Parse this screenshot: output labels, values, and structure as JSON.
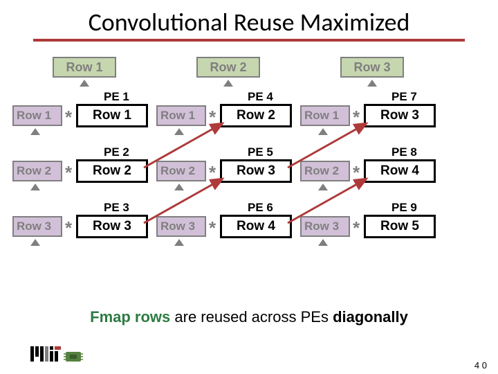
{
  "title": "Convolutional Reuse Maximized",
  "fmap_top": [
    "Row 1",
    "Row 2",
    "Row 3"
  ],
  "filter_labels": [
    "Row 1",
    "Row 2",
    "Row 3"
  ],
  "asterisk": "*",
  "grid": {
    "col1": {
      "pe": [
        "PE 1",
        "PE 2",
        "PE 3"
      ],
      "data": [
        "Row 1",
        "Row 2",
        "Row 3"
      ]
    },
    "col2": {
      "pe": [
        "PE 4",
        "PE 5",
        "PE 6"
      ],
      "data": [
        "Row 2",
        "Row 3",
        "Row 4"
      ]
    },
    "col3": {
      "pe": [
        "PE 7",
        "PE 8",
        "PE 9"
      ],
      "data": [
        "Row 3",
        "Row 4",
        "Row 5"
      ]
    }
  },
  "footer": {
    "fmap_word": "Fmap rows",
    "mid": " are reused across PEs ",
    "bold": "diagonally"
  },
  "page_number": "4\n0",
  "colors": {
    "accent_underline": "#ae3a3a",
    "filter_bg": "#d2c0d8",
    "fmap_bg": "#c6d6af",
    "grey": "#7f7f7f",
    "arrow": "#ae3a3a",
    "fmap_text": "#2d7b42"
  }
}
